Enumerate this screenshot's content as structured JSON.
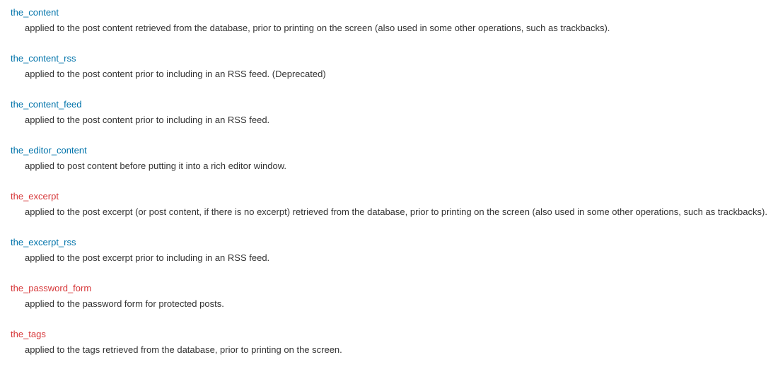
{
  "items": [
    {
      "term": "the_content",
      "linkClass": "blue-link",
      "description": "applied to the post content retrieved from the database, prior to printing on the screen (also used in some other operations, such as trackbacks)."
    },
    {
      "term": "the_content_rss",
      "linkClass": "blue-link",
      "description": "applied to the post content prior to including in an RSS feed. (Deprecated)"
    },
    {
      "term": "the_content_feed",
      "linkClass": "blue-link",
      "description": "applied to the post content prior to including in an RSS feed."
    },
    {
      "term": "the_editor_content",
      "linkClass": "blue-link",
      "description": "applied to post content before putting it into a rich editor window."
    },
    {
      "term": "the_excerpt",
      "linkClass": "red-link",
      "description": "applied to the post excerpt (or post content, if there is no excerpt) retrieved from the database, prior to printing on the screen (also used in some other operations, such as trackbacks)."
    },
    {
      "term": "the_excerpt_rss",
      "linkClass": "blue-link",
      "description": "applied to the post excerpt prior to including in an RSS feed."
    },
    {
      "term": "the_password_form",
      "linkClass": "red-link",
      "description": "applied to the password form for protected posts."
    },
    {
      "term": "the_tags",
      "linkClass": "red-link",
      "description": "applied to the tags retrieved from the database, prior to printing on the screen."
    }
  ]
}
